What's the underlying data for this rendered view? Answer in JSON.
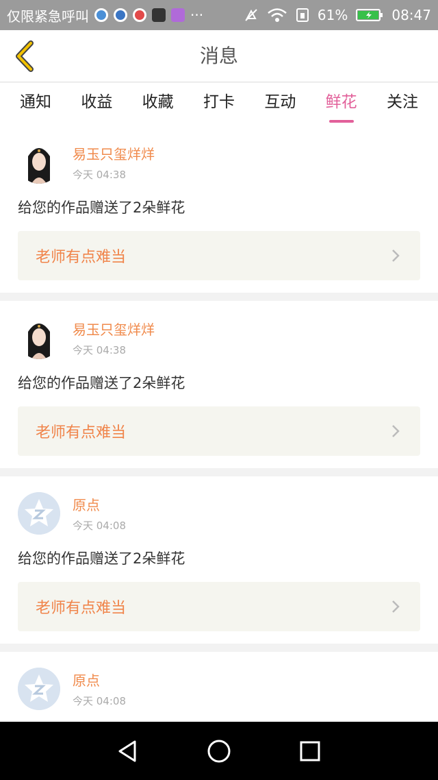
{
  "status_bar": {
    "carrier_text": "仅限紧急呼叫",
    "more": "···",
    "battery": "61%",
    "time": "08:47"
  },
  "header": {
    "title": "消息"
  },
  "tabs": [
    {
      "label": "通知",
      "active": false
    },
    {
      "label": "收益",
      "active": false
    },
    {
      "label": "收藏",
      "active": false
    },
    {
      "label": "打卡",
      "active": false
    },
    {
      "label": "互动",
      "active": false
    },
    {
      "label": "鲜花",
      "active": true
    },
    {
      "label": "关注",
      "active": false
    }
  ],
  "messages": [
    {
      "user": "易玉只玺烊烊",
      "time": "今天 04:38",
      "text": "给您的作品赠送了2朵鲜花",
      "work": "老师有点难当",
      "avatar": "portrait"
    },
    {
      "user": "易玉只玺烊烊",
      "time": "今天 04:38",
      "text": "给您的作品赠送了2朵鲜花",
      "work": "老师有点难当",
      "avatar": "portrait"
    },
    {
      "user": "原点",
      "time": "今天 04:08",
      "text": "给您的作品赠送了2朵鲜花",
      "work": "老师有点难当",
      "avatar": "default"
    },
    {
      "user": "原点",
      "time": "今天 04:08",
      "text": "",
      "work": "",
      "avatar": "default"
    }
  ],
  "colors": {
    "accent": "#e2609a",
    "name": "#f08a4b",
    "work": "#f0844a",
    "back": "#f2c200"
  }
}
